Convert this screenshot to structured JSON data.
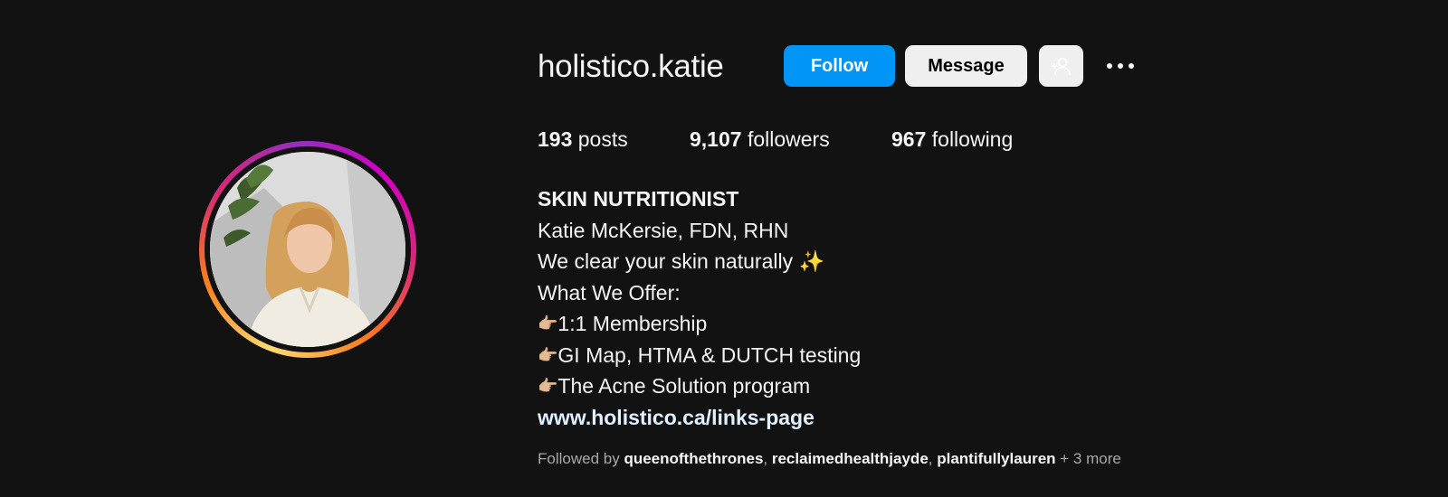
{
  "profile": {
    "username": "holistico.katie",
    "avatar_alt": "profile photo with story ring",
    "colors": {
      "follow_bg": "#0095f6",
      "link": "#e0f1ff",
      "background": "#121212"
    }
  },
  "actions": {
    "follow_label": "Follow",
    "message_label": "Message",
    "suggest_icon": "add-person-icon",
    "more_icon": "more-options-icon"
  },
  "stats": {
    "posts_count": "193",
    "posts_label": "posts",
    "followers_count": "9,107",
    "followers_label": "followers",
    "following_count": "967",
    "following_label": "following"
  },
  "bio": {
    "category": "SKIN NUTRITIONIST",
    "name_line": "Katie McKersie, FDN, RHN",
    "tagline": "We clear your skin naturally",
    "tagline_emoji": "✨",
    "offer_heading": "What We Offer:",
    "pointer_glyph": "👉🏼",
    "offers": [
      "1:1 Membership",
      "GI Map, HTMA & DUTCH testing",
      "The Acne Solution program"
    ],
    "link": "www.holistico.ca/links-page"
  },
  "followed_by": {
    "prefix": "Followed by",
    "accounts": [
      "queenofthethrones",
      "reclaimedhealthjayde",
      "plantifullylauren"
    ],
    "more": "+ 3 more"
  }
}
